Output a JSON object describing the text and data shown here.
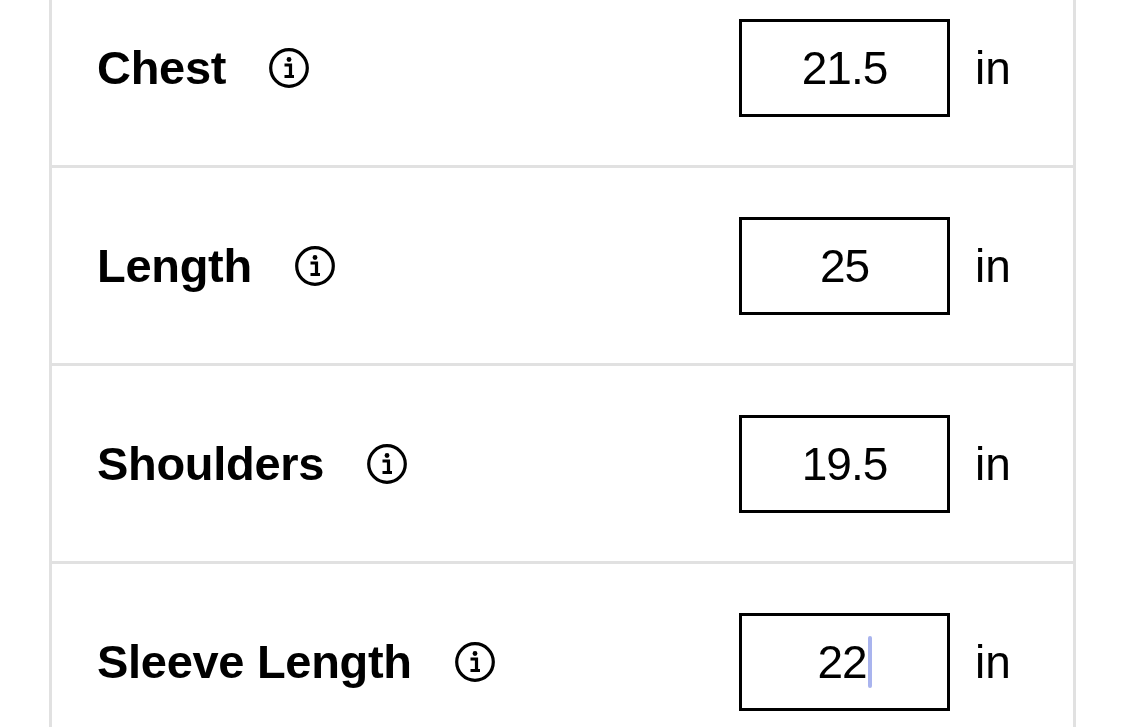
{
  "measurements": [
    {
      "label": "Chest",
      "value": "21.5",
      "unit": "in",
      "focused": false
    },
    {
      "label": "Length",
      "value": "25",
      "unit": "in",
      "focused": false
    },
    {
      "label": "Shoulders",
      "value": "19.5",
      "unit": "in",
      "focused": false
    },
    {
      "label": "Sleeve Length",
      "value": "22",
      "unit": "in",
      "focused": true
    }
  ]
}
